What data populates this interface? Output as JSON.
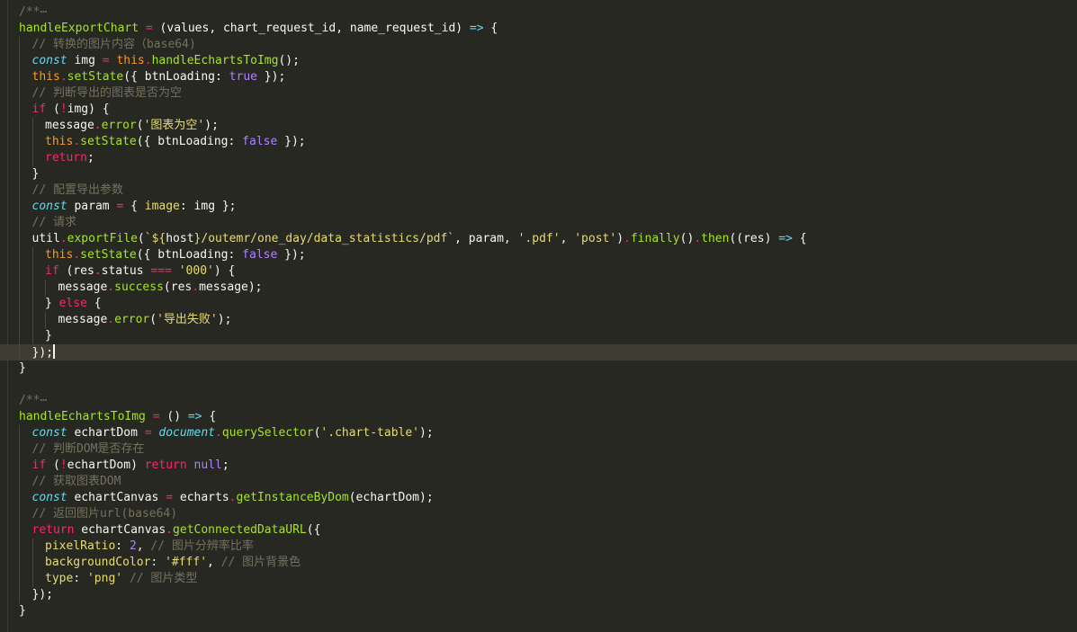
{
  "editor": {
    "colors": {
      "background": "#272822",
      "active_line": "#3e3d32",
      "default": "#f8f8f2",
      "keyword": "#f92672",
      "storage": "#66d9ef",
      "string": "#e6db74",
      "function": "#a6e22e",
      "constant": "#ae81ff",
      "comment": "#75715e",
      "param": "#fd971f"
    },
    "lines": [
      {
        "indent": 0,
        "tokens": [
          {
            "t": "/**",
            "c": "comment"
          },
          {
            "t": "⋯",
            "c": "comment"
          }
        ]
      },
      {
        "indent": 0,
        "tokens": [
          {
            "t": "handleExportChart",
            "c": "function"
          },
          {
            "t": " ",
            "c": "default"
          },
          {
            "t": "=",
            "c": "keyword"
          },
          {
            "t": " (values, chart_request_id, name_request_id) ",
            "c": "default"
          },
          {
            "t": "=>",
            "c": "storage"
          },
          {
            "t": " {",
            "c": "default"
          }
        ]
      },
      {
        "indent": 1,
        "tokens": [
          {
            "t": "// 转换的图片内容（base64)",
            "c": "comment"
          }
        ]
      },
      {
        "indent": 1,
        "tokens": [
          {
            "t": "const",
            "c": "storage-italic"
          },
          {
            "t": " img ",
            "c": "default"
          },
          {
            "t": "=",
            "c": "keyword"
          },
          {
            "t": " ",
            "c": "default"
          },
          {
            "t": "this",
            "c": "param"
          },
          {
            "t": ".",
            "c": "keyword"
          },
          {
            "t": "handleEchartsToImg",
            "c": "function"
          },
          {
            "t": "();",
            "c": "default"
          }
        ]
      },
      {
        "indent": 1,
        "tokens": [
          {
            "t": "this",
            "c": "param"
          },
          {
            "t": ".",
            "c": "keyword"
          },
          {
            "t": "setState",
            "c": "function"
          },
          {
            "t": "({ btnLoading: ",
            "c": "default"
          },
          {
            "t": "true",
            "c": "constant"
          },
          {
            "t": " });",
            "c": "default"
          }
        ]
      },
      {
        "indent": 1,
        "tokens": [
          {
            "t": "// 判断导出的图表是否为空",
            "c": "comment"
          }
        ]
      },
      {
        "indent": 1,
        "tokens": [
          {
            "t": "if",
            "c": "keyword"
          },
          {
            "t": " (",
            "c": "default"
          },
          {
            "t": "!",
            "c": "keyword"
          },
          {
            "t": "img) {",
            "c": "default"
          }
        ]
      },
      {
        "indent": 2,
        "tokens": [
          {
            "t": "message",
            "c": "default"
          },
          {
            "t": ".",
            "c": "keyword"
          },
          {
            "t": "error",
            "c": "function"
          },
          {
            "t": "(",
            "c": "default"
          },
          {
            "t": "'图表为空'",
            "c": "string"
          },
          {
            "t": ");",
            "c": "default"
          }
        ]
      },
      {
        "indent": 2,
        "tokens": [
          {
            "t": "this",
            "c": "param"
          },
          {
            "t": ".",
            "c": "keyword"
          },
          {
            "t": "setState",
            "c": "function"
          },
          {
            "t": "({ btnLoading: ",
            "c": "default"
          },
          {
            "t": "false",
            "c": "constant"
          },
          {
            "t": " });",
            "c": "default"
          }
        ]
      },
      {
        "indent": 2,
        "tokens": [
          {
            "t": "return",
            "c": "keyword"
          },
          {
            "t": ";",
            "c": "default"
          }
        ]
      },
      {
        "indent": 1,
        "tokens": [
          {
            "t": "}",
            "c": "default"
          }
        ]
      },
      {
        "indent": 1,
        "tokens": [
          {
            "t": "// 配置导出参数",
            "c": "comment"
          }
        ]
      },
      {
        "indent": 1,
        "tokens": [
          {
            "t": "const",
            "c": "storage-italic"
          },
          {
            "t": " param ",
            "c": "default"
          },
          {
            "t": "=",
            "c": "keyword"
          },
          {
            "t": " { ",
            "c": "default"
          },
          {
            "t": "image",
            "c": "string"
          },
          {
            "t": ": img };",
            "c": "default"
          }
        ]
      },
      {
        "indent": 1,
        "tokens": [
          {
            "t": "// 请求",
            "c": "comment"
          }
        ]
      },
      {
        "indent": 1,
        "tokens": [
          {
            "t": "util",
            "c": "default"
          },
          {
            "t": ".",
            "c": "keyword"
          },
          {
            "t": "exportFile",
            "c": "function"
          },
          {
            "t": "(",
            "c": "default"
          },
          {
            "t": "`${",
            "c": "string"
          },
          {
            "t": "host",
            "c": "default"
          },
          {
            "t": "}/outemr/one_day/data_statistics/pdf`",
            "c": "string"
          },
          {
            "t": ", param, ",
            "c": "default"
          },
          {
            "t": "'.pdf'",
            "c": "string"
          },
          {
            "t": ", ",
            "c": "default"
          },
          {
            "t": "'post'",
            "c": "string"
          },
          {
            "t": ")",
            "c": "default"
          },
          {
            "t": ".",
            "c": "keyword"
          },
          {
            "t": "finally",
            "c": "function"
          },
          {
            "t": "()",
            "c": "default"
          },
          {
            "t": ".",
            "c": "keyword"
          },
          {
            "t": "then",
            "c": "function"
          },
          {
            "t": "((res) ",
            "c": "default"
          },
          {
            "t": "=>",
            "c": "storage"
          },
          {
            "t": " {",
            "c": "default"
          }
        ]
      },
      {
        "indent": 2,
        "tokens": [
          {
            "t": "this",
            "c": "param"
          },
          {
            "t": ".",
            "c": "keyword"
          },
          {
            "t": "setState",
            "c": "function"
          },
          {
            "t": "({ btnLoading: ",
            "c": "default"
          },
          {
            "t": "false",
            "c": "constant"
          },
          {
            "t": " });",
            "c": "default"
          }
        ]
      },
      {
        "indent": 2,
        "tokens": [
          {
            "t": "if",
            "c": "keyword"
          },
          {
            "t": " (res",
            "c": "default"
          },
          {
            "t": ".",
            "c": "keyword"
          },
          {
            "t": "status ",
            "c": "default"
          },
          {
            "t": "===",
            "c": "keyword"
          },
          {
            "t": " ",
            "c": "default"
          },
          {
            "t": "'000'",
            "c": "string"
          },
          {
            "t": ") {",
            "c": "default"
          }
        ]
      },
      {
        "indent": 3,
        "tokens": [
          {
            "t": "message",
            "c": "default"
          },
          {
            "t": ".",
            "c": "keyword"
          },
          {
            "t": "success",
            "c": "function"
          },
          {
            "t": "(res",
            "c": "default"
          },
          {
            "t": ".",
            "c": "keyword"
          },
          {
            "t": "message);",
            "c": "default"
          }
        ]
      },
      {
        "indent": 2,
        "tokens": [
          {
            "t": "} ",
            "c": "default"
          },
          {
            "t": "else",
            "c": "keyword"
          },
          {
            "t": " {",
            "c": "default"
          }
        ]
      },
      {
        "indent": 3,
        "tokens": [
          {
            "t": "message",
            "c": "default"
          },
          {
            "t": ".",
            "c": "keyword"
          },
          {
            "t": "error",
            "c": "function"
          },
          {
            "t": "(",
            "c": "default"
          },
          {
            "t": "'导出失败'",
            "c": "string"
          },
          {
            "t": ");",
            "c": "default"
          }
        ]
      },
      {
        "indent": 2,
        "tokens": [
          {
            "t": "}",
            "c": "default"
          }
        ]
      },
      {
        "indent": 1,
        "active": true,
        "cursor": true,
        "tokens": [
          {
            "t": "});",
            "c": "default"
          }
        ]
      },
      {
        "indent": 0,
        "tokens": [
          {
            "t": "}",
            "c": "default"
          }
        ]
      },
      {
        "indent": 0,
        "tokens": []
      },
      {
        "indent": 0,
        "tokens": [
          {
            "t": "/**",
            "c": "comment"
          },
          {
            "t": "⋯",
            "c": "comment"
          }
        ]
      },
      {
        "indent": 0,
        "tokens": [
          {
            "t": "handleEchartsToImg",
            "c": "function"
          },
          {
            "t": " ",
            "c": "default"
          },
          {
            "t": "=",
            "c": "keyword"
          },
          {
            "t": " () ",
            "c": "default"
          },
          {
            "t": "=>",
            "c": "storage"
          },
          {
            "t": " {",
            "c": "default"
          }
        ]
      },
      {
        "indent": 1,
        "tokens": [
          {
            "t": "const",
            "c": "storage-italic"
          },
          {
            "t": " echartDom ",
            "c": "default"
          },
          {
            "t": "=",
            "c": "keyword"
          },
          {
            "t": " ",
            "c": "default"
          },
          {
            "t": "document",
            "c": "storage-italic"
          },
          {
            "t": ".",
            "c": "keyword"
          },
          {
            "t": "querySelector",
            "c": "function"
          },
          {
            "t": "(",
            "c": "default"
          },
          {
            "t": "'.chart-table'",
            "c": "string"
          },
          {
            "t": ");",
            "c": "default"
          }
        ]
      },
      {
        "indent": 1,
        "tokens": [
          {
            "t": "// 判断DOM是否存在",
            "c": "comment"
          }
        ]
      },
      {
        "indent": 1,
        "tokens": [
          {
            "t": "if",
            "c": "keyword"
          },
          {
            "t": " (",
            "c": "default"
          },
          {
            "t": "!",
            "c": "keyword"
          },
          {
            "t": "echartDom) ",
            "c": "default"
          },
          {
            "t": "return",
            "c": "keyword"
          },
          {
            "t": " ",
            "c": "default"
          },
          {
            "t": "null",
            "c": "constant"
          },
          {
            "t": ";",
            "c": "default"
          }
        ]
      },
      {
        "indent": 1,
        "tokens": [
          {
            "t": "// 获取图表DOM",
            "c": "comment"
          }
        ]
      },
      {
        "indent": 1,
        "tokens": [
          {
            "t": "const",
            "c": "storage-italic"
          },
          {
            "t": " echartCanvas ",
            "c": "default"
          },
          {
            "t": "=",
            "c": "keyword"
          },
          {
            "t": " echarts",
            "c": "default"
          },
          {
            "t": ".",
            "c": "keyword"
          },
          {
            "t": "getInstanceByDom",
            "c": "function"
          },
          {
            "t": "(echartDom);",
            "c": "default"
          }
        ]
      },
      {
        "indent": 1,
        "tokens": [
          {
            "t": "// 返回图片url(base64)",
            "c": "comment"
          }
        ]
      },
      {
        "indent": 1,
        "tokens": [
          {
            "t": "return",
            "c": "keyword"
          },
          {
            "t": " echartCanvas",
            "c": "default"
          },
          {
            "t": ".",
            "c": "keyword"
          },
          {
            "t": "getConnectedDataURL",
            "c": "function"
          },
          {
            "t": "({",
            "c": "default"
          }
        ]
      },
      {
        "indent": 2,
        "tokens": [
          {
            "t": "pixelRatio",
            "c": "string"
          },
          {
            "t": ": ",
            "c": "default"
          },
          {
            "t": "2",
            "c": "constant"
          },
          {
            "t": ", ",
            "c": "default"
          },
          {
            "t": "// 图片分辨率比率",
            "c": "comment"
          }
        ]
      },
      {
        "indent": 2,
        "tokens": [
          {
            "t": "backgroundColor",
            "c": "string"
          },
          {
            "t": ": ",
            "c": "default"
          },
          {
            "t": "'#fff'",
            "c": "string"
          },
          {
            "t": ", ",
            "c": "default"
          },
          {
            "t": "// 图片背景色",
            "c": "comment"
          }
        ]
      },
      {
        "indent": 2,
        "tokens": [
          {
            "t": "type",
            "c": "string"
          },
          {
            "t": ": ",
            "c": "default"
          },
          {
            "t": "'png'",
            "c": "string"
          },
          {
            "t": " ",
            "c": "default"
          },
          {
            "t": "// 图片类型",
            "c": "comment"
          }
        ]
      },
      {
        "indent": 1,
        "tokens": [
          {
            "t": "});",
            "c": "default"
          }
        ]
      },
      {
        "indent": 0,
        "tokens": [
          {
            "t": "}",
            "c": "default"
          }
        ]
      }
    ]
  }
}
